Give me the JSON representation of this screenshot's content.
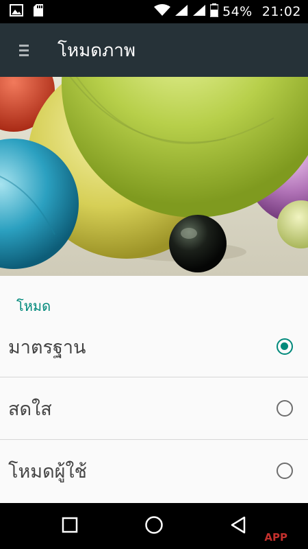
{
  "status_bar": {
    "battery_percent": "54%",
    "time": "21:02",
    "icons": [
      "gallery-icon",
      "sd-card-icon",
      "wifi-icon",
      "signal-icon",
      "signal-icon",
      "battery-icon"
    ]
  },
  "app_bar": {
    "title": "โหมดภาพ",
    "menu_icon": "menu-icon"
  },
  "section": {
    "header": "โหมด"
  },
  "options": [
    {
      "label": "มาตรฐาน",
      "selected": true
    },
    {
      "label": "สดใส",
      "selected": false
    },
    {
      "label": "โหมดผู้ใช้",
      "selected": false
    }
  ],
  "nav_bar": {
    "icons": [
      "recents-icon",
      "home-icon",
      "back-icon"
    ]
  },
  "watermark": "APP",
  "colors": {
    "accent": "#00897b",
    "app_bar": "#263238",
    "status_bar": "#000000"
  }
}
